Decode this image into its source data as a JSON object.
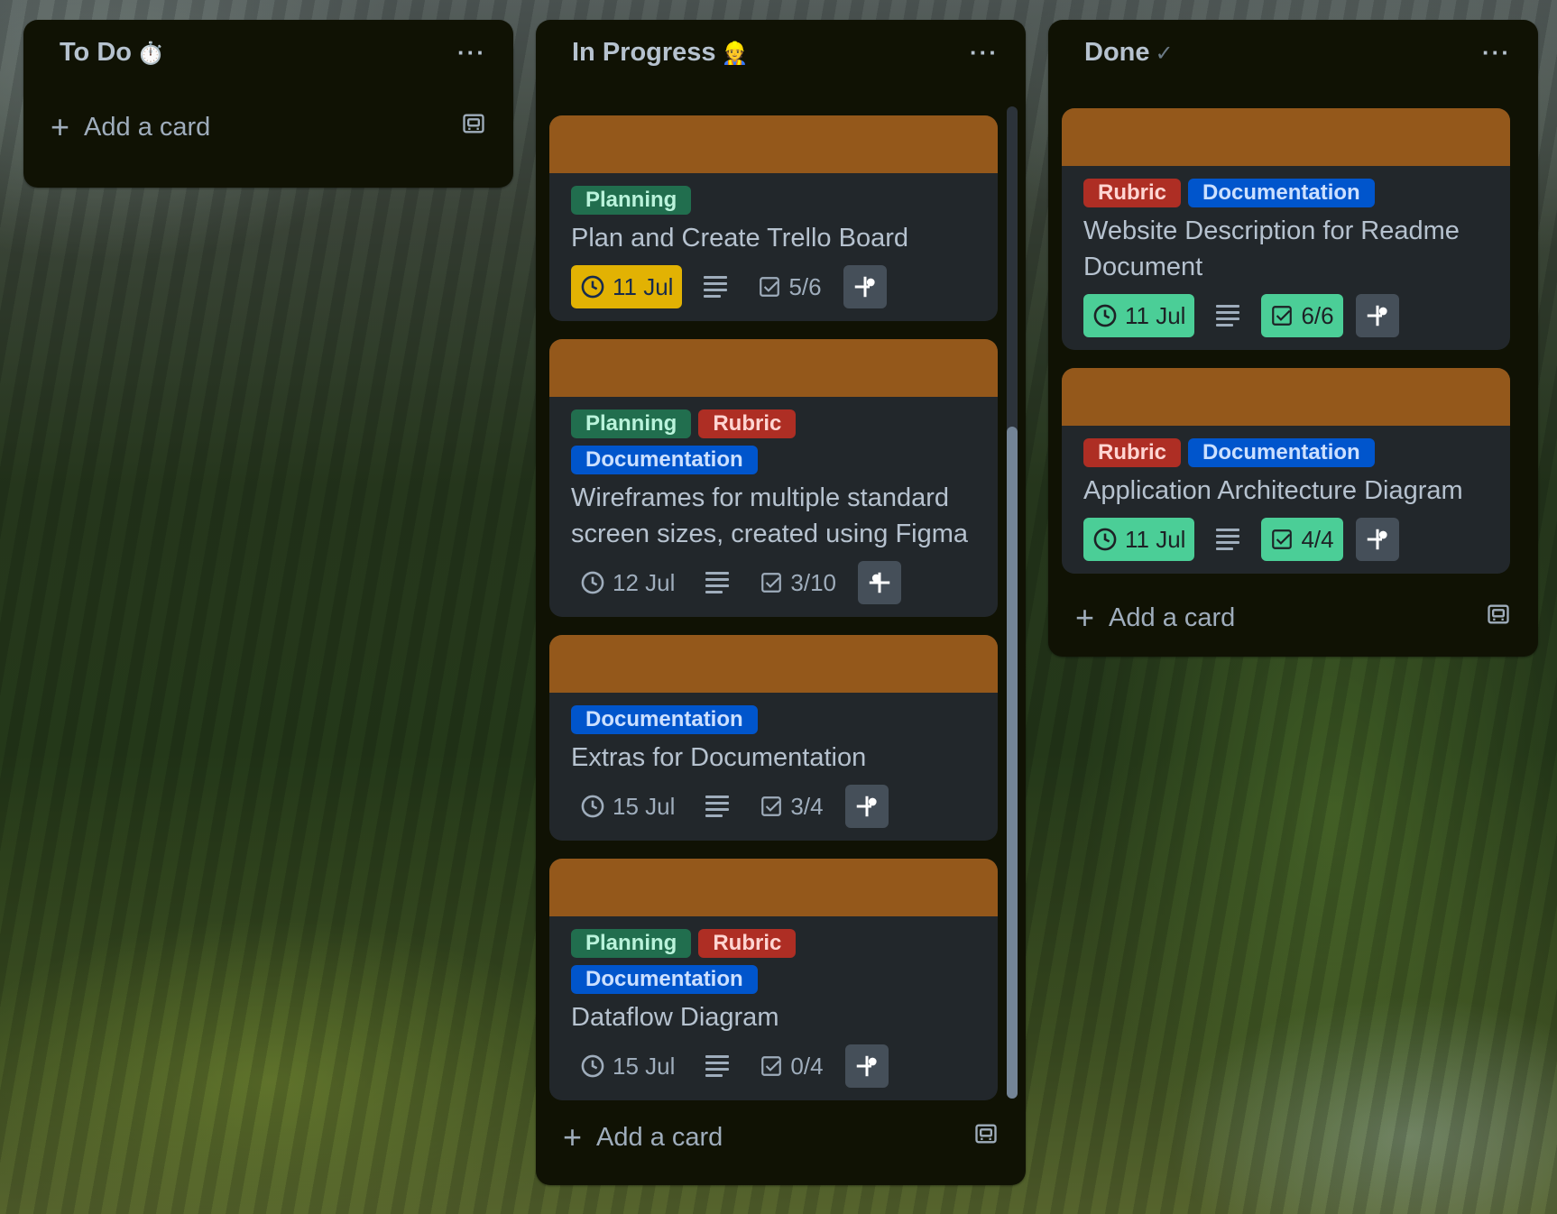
{
  "colors": {
    "list_bg": "#101204",
    "card_bg": "#22272b",
    "card_cover": "#94581b",
    "label_planning": "#216e4e",
    "label_rubric": "#ae2e24",
    "label_documentation": "#0055cc",
    "due_soon": "#e2b203",
    "complete": "#4bce97"
  },
  "lists": [
    {
      "title": "To Do",
      "emoji": "⏱️",
      "menu_icon": "ellipsis-icon",
      "add_card": "Add a card",
      "cards": []
    },
    {
      "title": "In Progress",
      "emoji": "👷",
      "menu_icon": "ellipsis-icon",
      "add_card": "Add a card",
      "cards": [
        {
          "labels": [
            "Planning"
          ],
          "title": "Plan and Create Trello Board",
          "due": "11 Jul",
          "due_state": "due-soon",
          "checklist": "5/6",
          "checklist_state": "plain"
        },
        {
          "labels": [
            "Planning",
            "Rubric",
            "Documentation"
          ],
          "title": "Wireframes for multiple standard screen sizes, created using Figma",
          "due": "12 Jul",
          "due_state": "plain",
          "checklist": "3/10",
          "checklist_state": "plain"
        },
        {
          "labels": [
            "Documentation"
          ],
          "title": "Extras for Documentation",
          "due": "15 Jul",
          "due_state": "plain",
          "checklist": "3/4",
          "checklist_state": "plain"
        },
        {
          "labels": [
            "Planning",
            "Rubric",
            "Documentation"
          ],
          "title": "Dataflow Diagram",
          "due": "15 Jul",
          "due_state": "plain",
          "checklist": "0/4",
          "checklist_state": "plain"
        }
      ]
    },
    {
      "title": "Done",
      "emoji": "✓",
      "menu_icon": "ellipsis-icon",
      "add_card": "Add a card",
      "cards": [
        {
          "labels": [
            "Rubric",
            "Documentation"
          ],
          "title": "Website Description for Readme Document",
          "due": "11 Jul",
          "due_state": "complete",
          "checklist": "6/6",
          "checklist_state": "complete"
        },
        {
          "labels": [
            "Rubric",
            "Documentation"
          ],
          "title": "Application Architecture Diagram",
          "due": "11 Jul",
          "due_state": "complete",
          "checklist": "4/4",
          "checklist_state": "complete"
        }
      ]
    }
  ]
}
